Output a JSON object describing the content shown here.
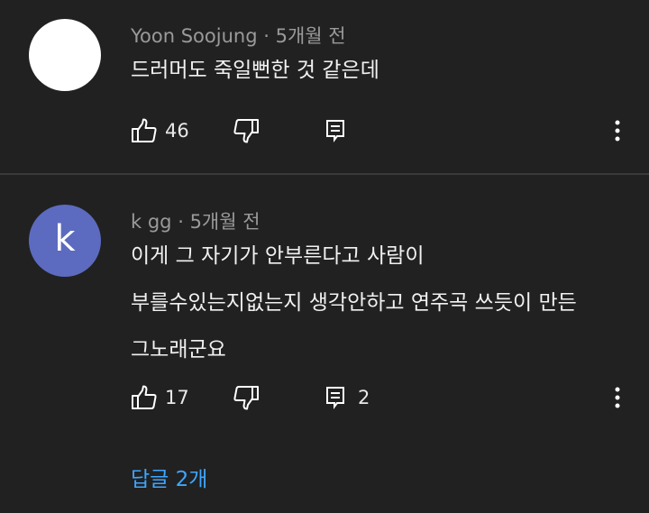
{
  "colors": {
    "background": "#212121",
    "meta": "#9a9a9a",
    "link": "#3ea6ff",
    "avatar_k": "#5c6bc0",
    "avatar_blank": "#ffffff"
  },
  "comments": [
    {
      "author": "Yoon Soojung",
      "separator": "·",
      "time": "5개월 전",
      "avatar_letter": "",
      "lines": [
        "드러머도 죽일뻔한 것 같은데"
      ],
      "likes": "46",
      "replies_count": ""
    },
    {
      "author": "k gg",
      "separator": "·",
      "time": "5개월 전",
      "avatar_letter": "k",
      "lines": [
        "이게 그 자기가 안부른다고 사람이",
        "부를수있는지없는지 생각안하고 연주곡 쓰듯이 만든",
        "그노래군요"
      ],
      "likes": "17",
      "replies_count": "2"
    }
  ],
  "replies_link": "답글 2개",
  "icons": [
    "thumbs-up-icon",
    "thumbs-down-icon",
    "reply-icon",
    "more-vert-icon"
  ]
}
